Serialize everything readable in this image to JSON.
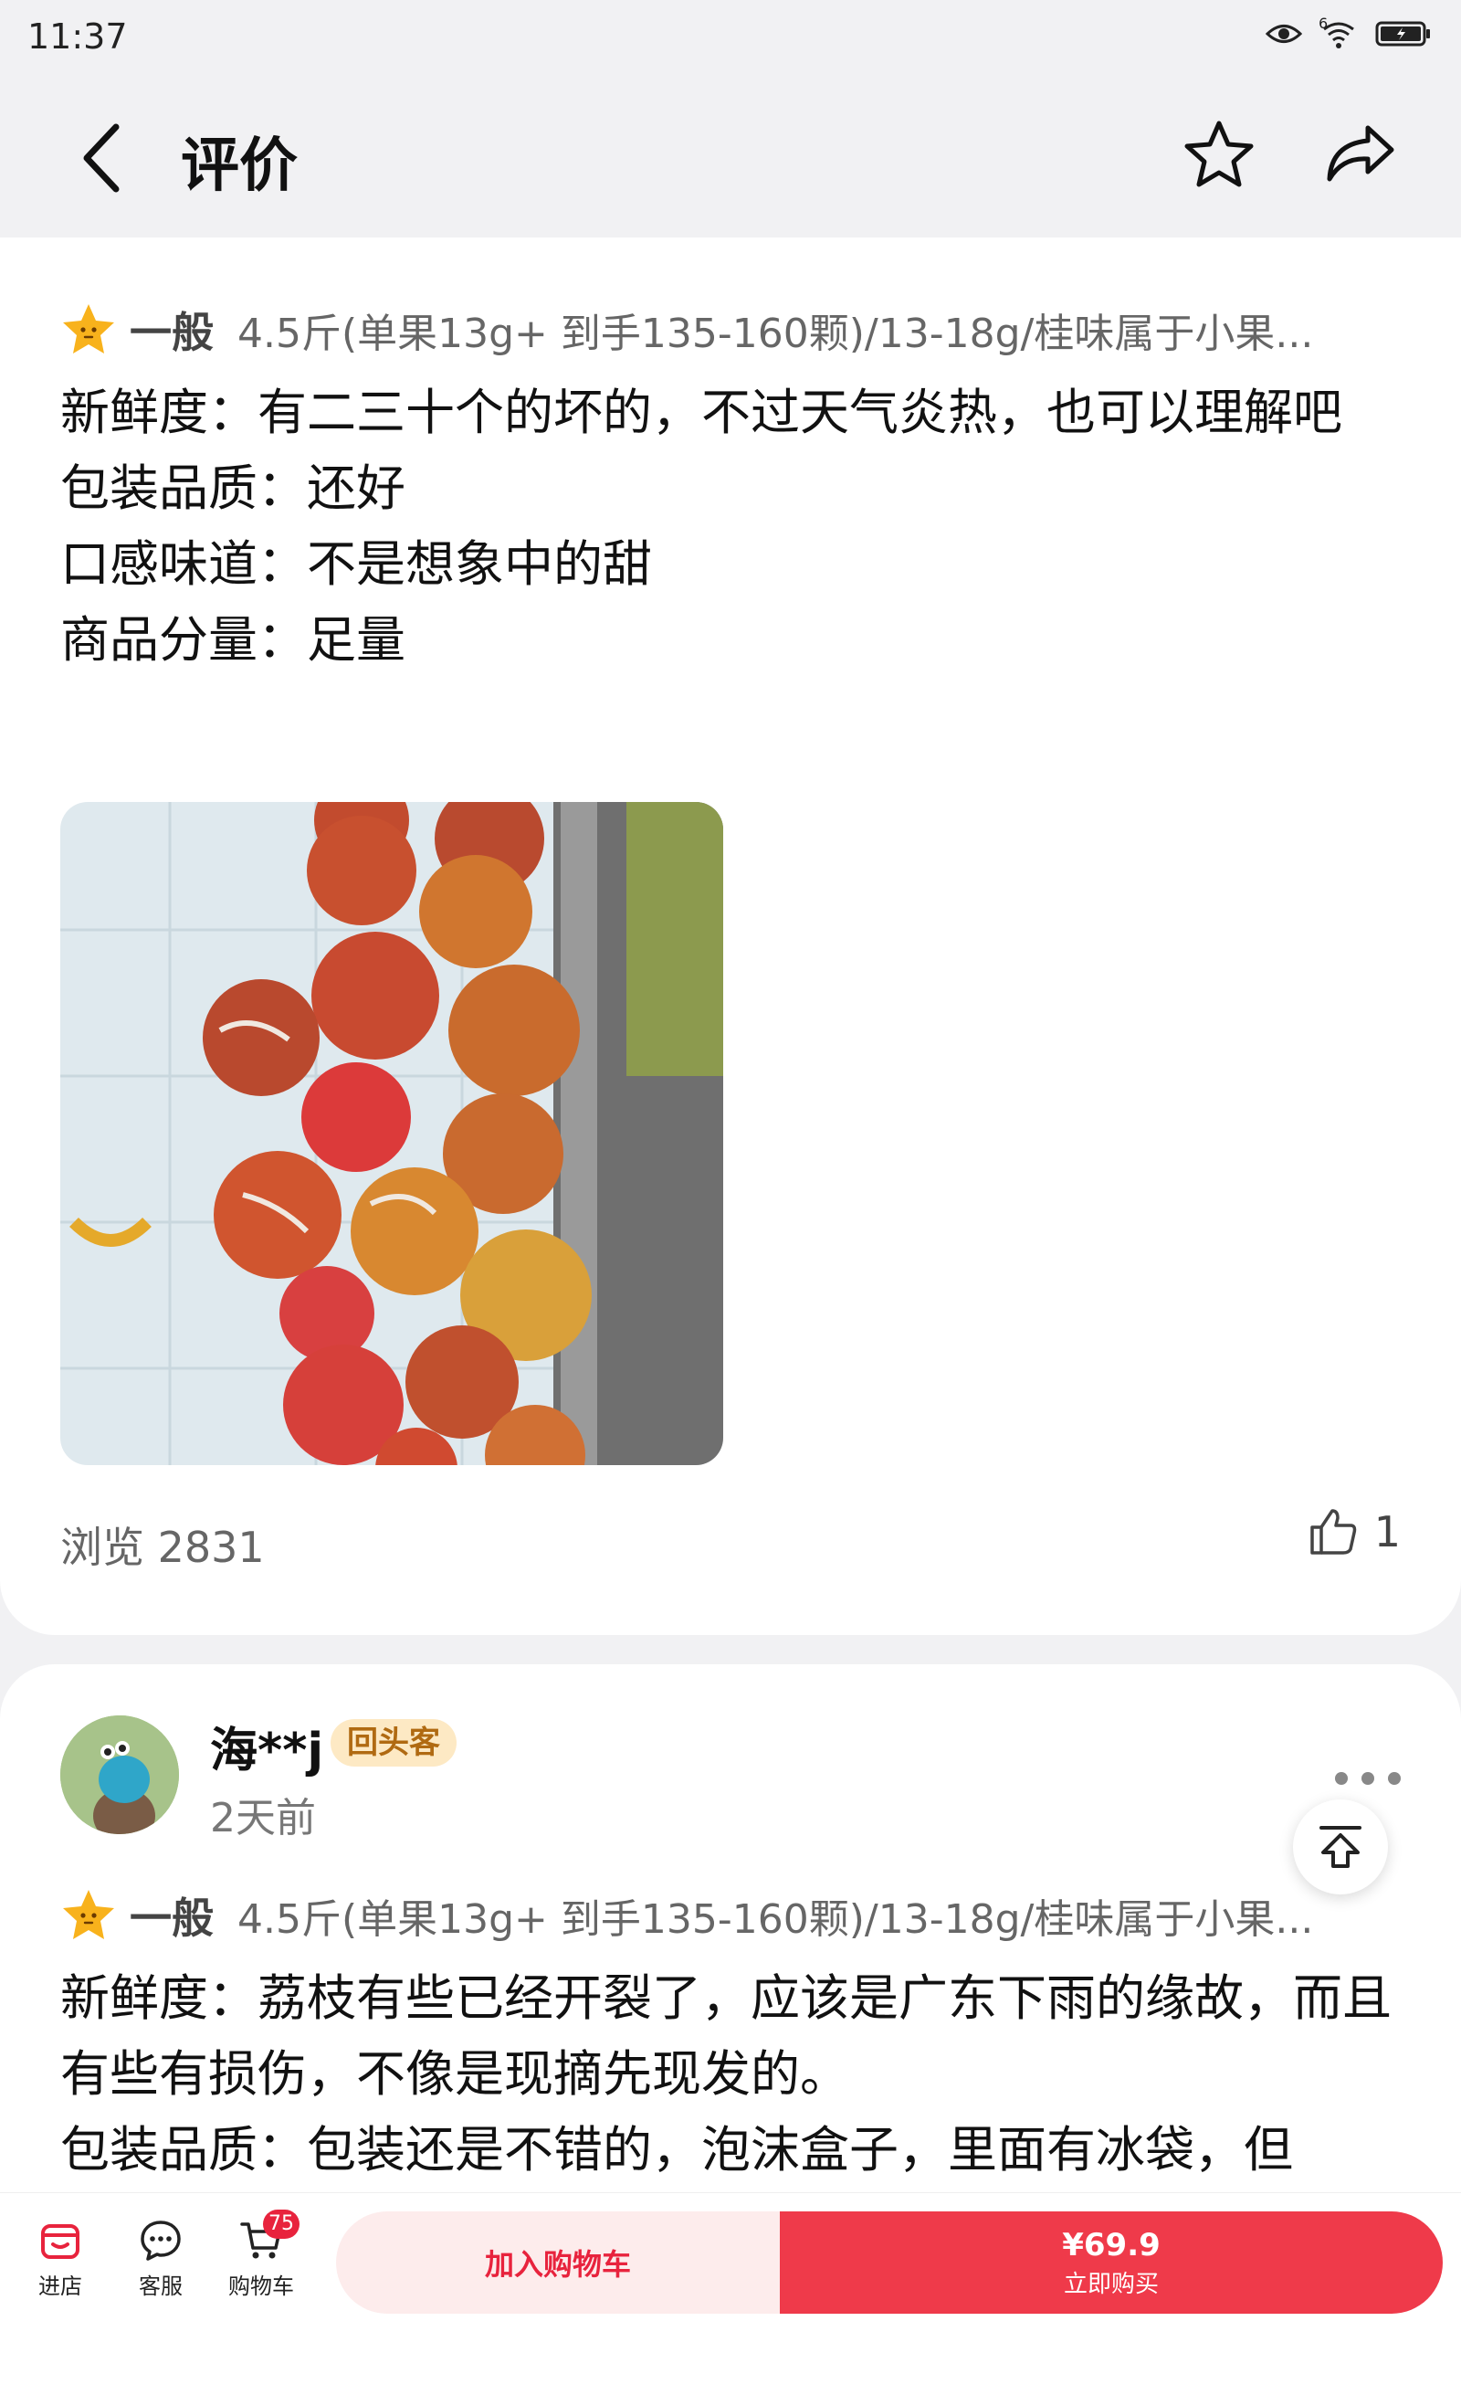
{
  "status": {
    "time": "11:37",
    "signal": "6"
  },
  "nav": {
    "title": "评价"
  },
  "review1": {
    "rating_label": "一般",
    "spec": "4.5斤(单果13g+ 到手135-160颗)/13-18g/桂味属于小果...",
    "lines": [
      "新鲜度：有二三十个的坏的，不过天气炎热，也可以理解吧",
      "包装品质：还好",
      "口感味道：不是想象中的甜",
      "商品分量：足量"
    ],
    "views": "浏览 2831",
    "likes": "1"
  },
  "review2": {
    "username": "海**j",
    "badge": "回头客",
    "time": "2天前",
    "rating_label": "一般",
    "spec": "4.5斤(单果13g+ 到手135-160颗)/13-18g/桂味属于小果...",
    "lines": [
      "新鲜度：荔枝有些已经开裂了，应该是广东下雨的缘故，而且有些有损伤，不像是现摘先现发的。",
      "包装品质：包装还是不错的，泡沫盒子，里面有冰袋，但"
    ]
  },
  "bottom": {
    "shop": "进店",
    "service": "客服",
    "cart": "购物车",
    "cart_count": "75",
    "add_cart": "加入购物车",
    "price": "¥69.9",
    "buy_now": "立即购买"
  },
  "colors": {
    "accent": "#ef3a4a",
    "badge_bg": "#fde9c4",
    "badge_text": "#b06a12"
  }
}
